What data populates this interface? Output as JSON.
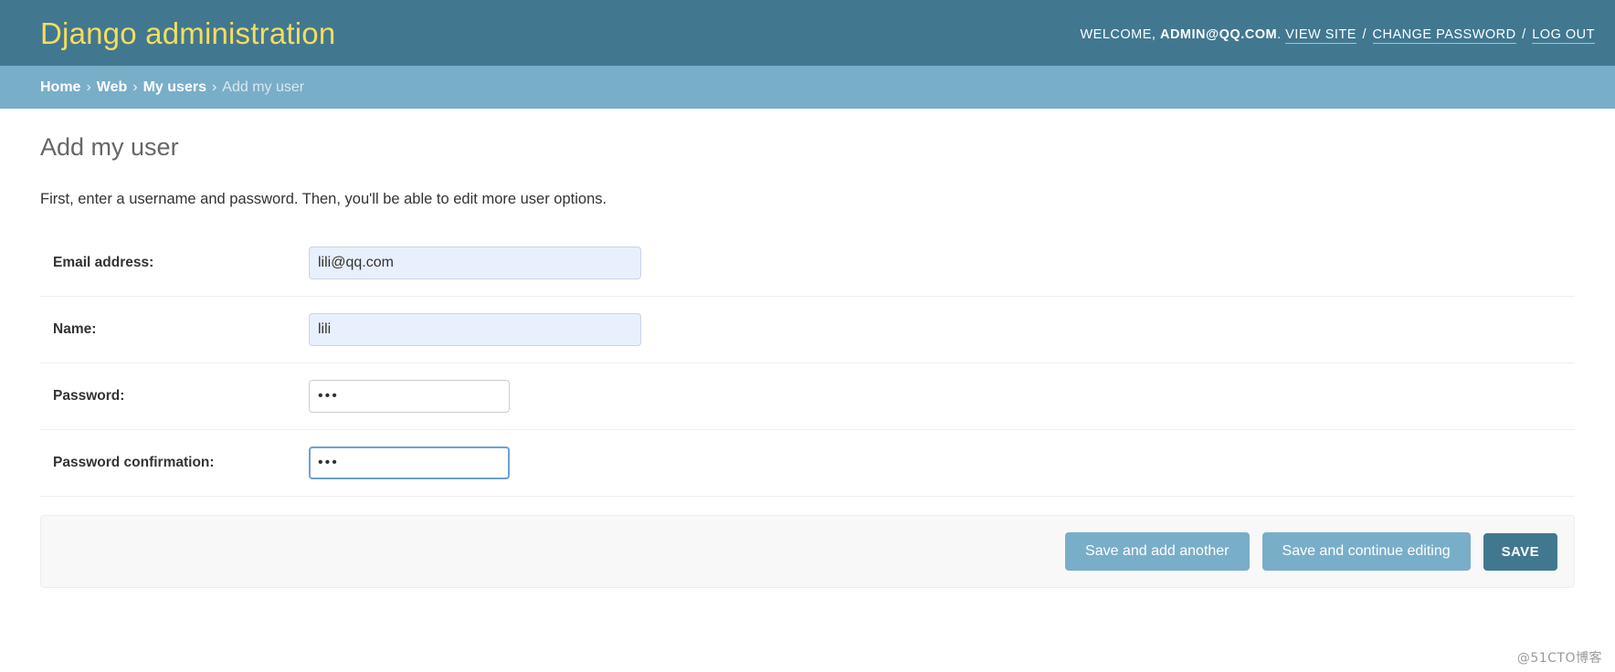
{
  "header": {
    "site_title": "Django administration",
    "welcome_prefix": "WELCOME,",
    "username": "ADMIN@QQ.COM",
    "username_suffix": ".",
    "view_site": "VIEW SITE",
    "separator": "/",
    "change_password": "CHANGE PASSWORD",
    "log_out": "LOG OUT",
    "bg_color": "#417890",
    "title_color": "#f5dd5d"
  },
  "breadcrumbs": {
    "items": [
      {
        "label": "Home",
        "current": false
      },
      {
        "label": "Web",
        "current": false
      },
      {
        "label": "My users",
        "current": false
      },
      {
        "label": "Add my user",
        "current": true
      }
    ],
    "separator": "›",
    "bg_color": "#79aec8"
  },
  "main": {
    "page_title": "Add my user",
    "help_text": "First, enter a username and password. Then, you'll be able to edit more user options."
  },
  "form": {
    "rows": [
      {
        "label": "Email address:",
        "value": "lili@qq.com",
        "placeholder": "",
        "type": "text",
        "state": "autofilled"
      },
      {
        "label": "Name:",
        "value": "lili",
        "placeholder": "",
        "type": "text",
        "state": "autofilled"
      },
      {
        "label": "Password:",
        "value": "•••",
        "placeholder": "",
        "type": "password",
        "state": "normal"
      },
      {
        "label": "Password confirmation:",
        "value": "•••",
        "placeholder": "",
        "type": "password",
        "state": "focused"
      }
    ]
  },
  "submit_row": {
    "save_and_add_another": "Save and add another",
    "save_and_continue": "Save and continue editing",
    "save": "SAVE",
    "secondary_color": "#79aec8",
    "primary_color": "#417890",
    "bg_color": "#f8f8f8"
  },
  "watermark": {
    "text": "@51CTO博客"
  }
}
